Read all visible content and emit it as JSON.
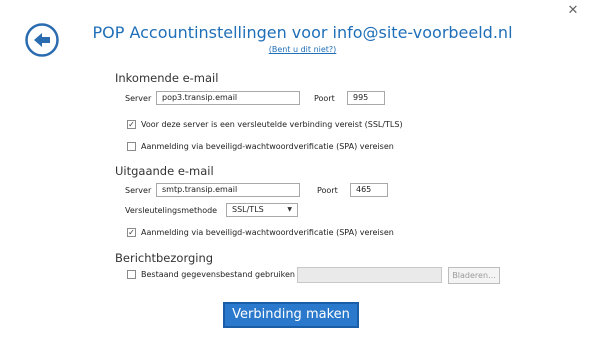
{
  "header": {
    "title": "POP Accountinstellingen voor info@site-voorbeeld.nl",
    "not_you": "(Bent u dit niet?)"
  },
  "incoming": {
    "section_title": "Inkomende e-mail",
    "server_label": "Server",
    "server_value": "pop3.transip.email",
    "port_label": "Poort",
    "port_value": "995",
    "ssl_label": "Voor deze server is een versleutelde verbinding vereist (SSL/TLS)",
    "ssl_checked": true,
    "spa_label": "Aanmelding via beveiligd-wachtwoordverificatie (SPA) vereisen",
    "spa_checked": false
  },
  "outgoing": {
    "section_title": "Uitgaande e-mail",
    "server_label": "Server",
    "server_value": "smtp.transip.email",
    "port_label": "Poort",
    "port_value": "465",
    "encryption_label": "Versleutelingsmethode",
    "encryption_value": "SSL/TLS",
    "spa_label": "Aanmelding via beveiligd-wachtwoordverificatie (SPA) vereisen",
    "spa_checked": true
  },
  "storage": {
    "section_title": "Berichtbezorging",
    "existing_label": "Bestaand gegevensbestand gebruiken",
    "existing_checked": false,
    "file_path": "",
    "browse_label": "Bladeren..."
  },
  "actions": {
    "connect_label": "Verbinding maken"
  },
  "icons": {
    "close": "close-icon",
    "back": "back-arrow-icon",
    "check": "checkmark-icon",
    "dropdown": "chevron-down-icon"
  },
  "colors": {
    "accent": "#1f6fb8",
    "primary_button": "#2b79cc"
  }
}
